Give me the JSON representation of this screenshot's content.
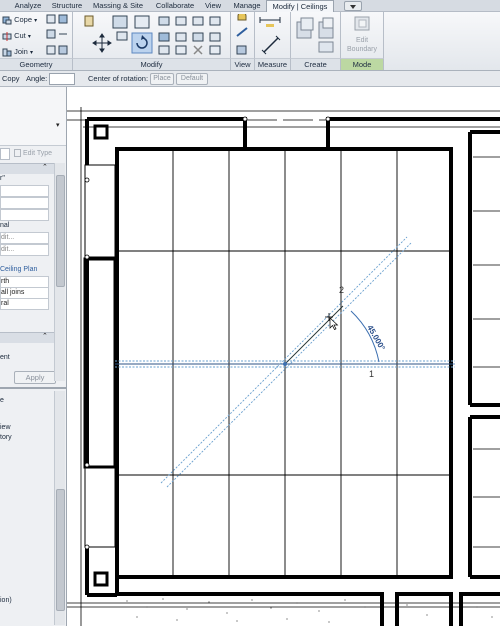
{
  "tabs": [
    {
      "label": "Analyze"
    },
    {
      "label": "Structure"
    },
    {
      "label": "Massing & Site"
    },
    {
      "label": "Collaborate"
    },
    {
      "label": "View"
    },
    {
      "label": "Manage"
    },
    {
      "label": "Modify | Ceilings",
      "active": true
    }
  ],
  "ribbon": {
    "geometry": {
      "cope": "Cope",
      "cut": "Cut",
      "join": "Join",
      "label": "Geometry"
    },
    "modify": {
      "label": "Modify"
    },
    "view": {
      "label": "View"
    },
    "measure": {
      "label": "Measure"
    },
    "create": {
      "label": "Create"
    },
    "mode": {
      "label": "Mode",
      "edit_boundary": "Edit Boundary"
    }
  },
  "options_bar": {
    "copy": "Copy",
    "angle_label": "Angle:",
    "angle_value": "",
    "center_label": "Center of rotation:",
    "place": "Place",
    "default": "Default"
  },
  "properties": {
    "edit_type": "Edit Type",
    "rows": [
      "r\"",
      "",
      "",
      "",
      "nal",
      "dit...",
      "dit..."
    ],
    "ceiling_plan": "Ceiling Plan",
    "rows2": [
      "rth",
      "all joins",
      "ral"
    ],
    "rows3": [
      "ent"
    ],
    "apply": "Apply"
  },
  "browser": {
    "rows": [
      "e",
      "iew",
      "tory"
    ],
    "bottom": "ion)"
  },
  "drawing": {
    "angle_text": "45.000°",
    "label_1": "1",
    "label_2": "2"
  },
  "colors": {
    "ribbon_bg": "#eef0f3",
    "mode_panel": "#bcd8a2",
    "selection_blue": "#4a7fc1",
    "wall_black": "#000000"
  }
}
